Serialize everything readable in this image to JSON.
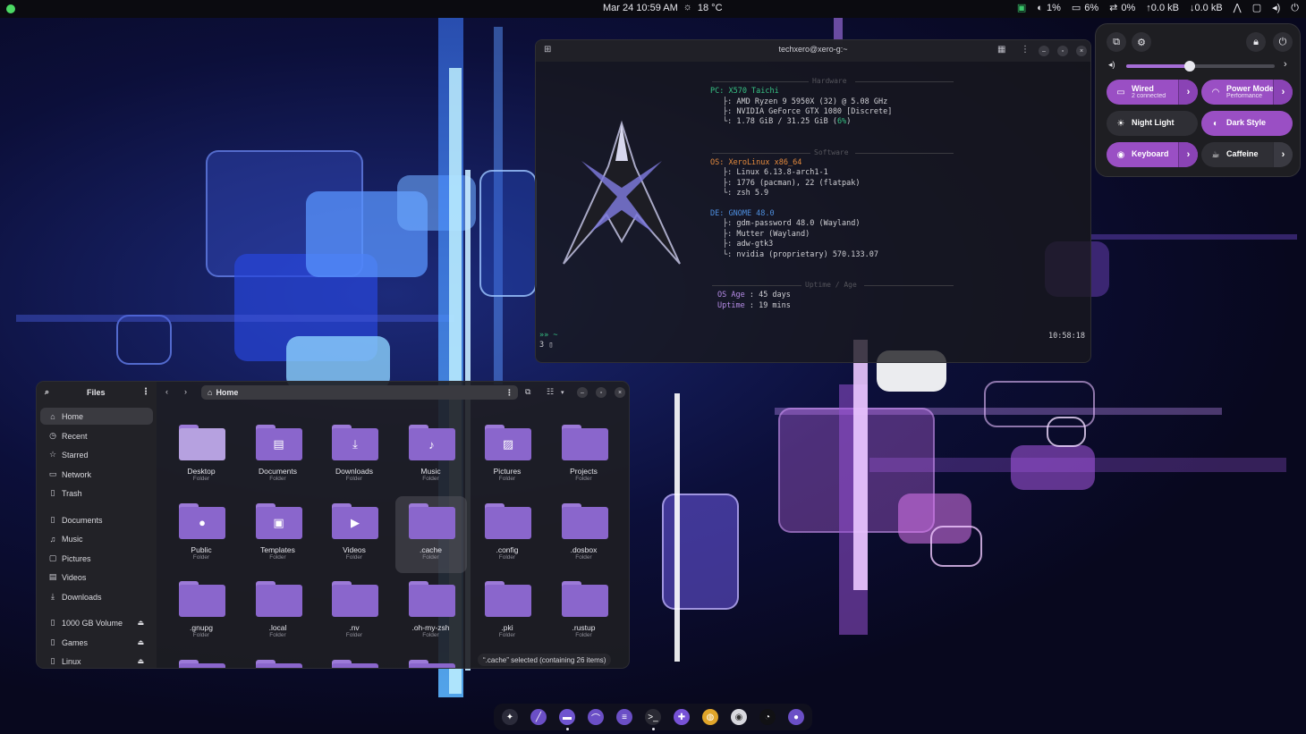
{
  "topbar": {
    "datetime": "Mar 24  10:59 AM",
    "weather": "18 °C",
    "cpu": "1%",
    "mem": "6%",
    "swap": "0%",
    "net_up": "↑0.0 kB",
    "net_down": "↓0.0 kB"
  },
  "quick_settings": {
    "volume_level": 0.43,
    "tiles": [
      {
        "label": "Wired",
        "sub": "2 connected",
        "on": true,
        "arrow": true,
        "icon": "wired-icon"
      },
      {
        "label": "Power Mode",
        "sub": "Performance",
        "on": true,
        "arrow": true,
        "icon": "power-mode-icon"
      },
      {
        "label": "Night Light",
        "sub": "",
        "on": false,
        "arrow": false,
        "icon": "night-light-icon"
      },
      {
        "label": "Dark Style",
        "sub": "",
        "on": true,
        "arrow": false,
        "icon": "dark-style-icon"
      },
      {
        "label": "Keyboard",
        "sub": "",
        "on": true,
        "arrow": true,
        "icon": "keyboard-icon"
      },
      {
        "label": "Caffeine",
        "sub": "",
        "on": false,
        "arrow": true,
        "icon": "caffeine-icon"
      }
    ]
  },
  "terminal": {
    "title": "techxero@xero-g:~",
    "hardware_title": "Hardware",
    "software_title": "Software",
    "uptime_title": "Uptime / Age",
    "hw": {
      "pc": "PC: X570 Taichi",
      "cpu": "├: AMD Ryzen 9 5950X (32) @ 5.08 GHz",
      "gpu": "├: NVIDIA GeForce GTX 1080 [Discrete]",
      "mem_prefix": "└: 1.78 GiB / 31.25 GiB (",
      "mem_pct": "6%",
      "mem_suffix": ")"
    },
    "sw": {
      "os": "OS: XeroLinux x86_64",
      "kernel": "├: Linux 6.13.8-arch1-1",
      "pkgs": "├: 1776 (pacman), 22 (flatpak)",
      "shell": "└: zsh 5.9",
      "de": "DE: GNOME 48.0",
      "dm": "├: gdm-password 48.0 (Wayland)",
      "wm": "├: Mutter (Wayland)",
      "theme": "├: adw-gtk3",
      "driver": "└: nvidia (proprietary) 570.133.07"
    },
    "age_label": "OS Age",
    "age_value": ": 45 days",
    "uptime_label": "Uptime",
    "uptime_value": ": 19 mins",
    "prompt_line1": "»» ~",
    "prompt_line2": "3 ▯",
    "clock": "10:58:18"
  },
  "files": {
    "sidebar_title": "Files",
    "path": "Home",
    "sidebar": [
      {
        "label": "Home",
        "icon": "home-icon",
        "active": true,
        "eject": false
      },
      {
        "label": "Recent",
        "icon": "recent-icon",
        "active": false,
        "eject": false
      },
      {
        "label": "Starred",
        "icon": "star-icon",
        "active": false,
        "eject": false
      },
      {
        "label": "Network",
        "icon": "network-icon",
        "active": false,
        "eject": false
      },
      {
        "label": "Trash",
        "icon": "trash-icon",
        "active": false,
        "eject": false
      },
      {
        "label": "Documents",
        "icon": "documents-icon",
        "active": false,
        "eject": false
      },
      {
        "label": "Music",
        "icon": "music-icon",
        "active": false,
        "eject": false
      },
      {
        "label": "Pictures",
        "icon": "pictures-icon",
        "active": false,
        "eject": false
      },
      {
        "label": "Videos",
        "icon": "videos-icon",
        "active": false,
        "eject": false
      },
      {
        "label": "Downloads",
        "icon": "downloads-icon",
        "active": false,
        "eject": false
      },
      {
        "label": "1000 GB Volume",
        "icon": "drive-icon",
        "active": false,
        "eject": true
      },
      {
        "label": "Games",
        "icon": "drive-icon",
        "active": false,
        "eject": true
      },
      {
        "label": "Linux",
        "icon": "drive-icon",
        "active": false,
        "eject": true
      }
    ],
    "items": [
      {
        "name": "Desktop",
        "type": "Folder",
        "emblem": ""
      },
      {
        "name": "Documents",
        "type": "Folder",
        "emblem": "documents"
      },
      {
        "name": "Downloads",
        "type": "Folder",
        "emblem": "downloads"
      },
      {
        "name": "Music",
        "type": "Folder",
        "emblem": "music"
      },
      {
        "name": "Pictures",
        "type": "Folder",
        "emblem": "pictures"
      },
      {
        "name": "Projects",
        "type": "Folder",
        "emblem": ""
      },
      {
        "name": "Public",
        "type": "Folder",
        "emblem": "public"
      },
      {
        "name": "Templates",
        "type": "Folder",
        "emblem": "templates"
      },
      {
        "name": "Videos",
        "type": "Folder",
        "emblem": "videos"
      },
      {
        "name": ".cache",
        "type": "Folder",
        "emblem": "",
        "selected": true
      },
      {
        "name": ".config",
        "type": "Folder",
        "emblem": ""
      },
      {
        "name": ".dosbox",
        "type": "Folder",
        "emblem": ""
      },
      {
        "name": ".gnupg",
        "type": "Folder",
        "emblem": ""
      },
      {
        "name": ".local",
        "type": "Folder",
        "emblem": ""
      },
      {
        "name": ".nv",
        "type": "Folder",
        "emblem": ""
      },
      {
        "name": ".oh-my-zsh",
        "type": "Folder",
        "emblem": ""
      },
      {
        "name": ".pki",
        "type": "Folder",
        "emblem": ""
      },
      {
        "name": ".rustup",
        "type": "Folder",
        "emblem": ""
      }
    ],
    "status": "“.cache” selected  (containing 26 items)"
  },
  "dock": [
    {
      "name": "xerolinux-icon",
      "color": "#2b2b3a",
      "glyph": "✦",
      "running": false
    },
    {
      "name": "sword-app-icon",
      "color": "#6b4fc6",
      "glyph": "╱",
      "running": false
    },
    {
      "name": "files-app-icon",
      "color": "#6f55cf",
      "glyph": "▬",
      "running": true
    },
    {
      "name": "network-app-icon",
      "color": "#6b4fc6",
      "glyph": "⌒",
      "running": false
    },
    {
      "name": "settings-app-icon",
      "color": "#6b4fc6",
      "glyph": "≡",
      "running": false
    },
    {
      "name": "terminal-app-icon",
      "color": "#2a2a34",
      "glyph": ">_",
      "running": true
    },
    {
      "name": "extensions-app-icon",
      "color": "#7752d6",
      "glyph": "✚",
      "running": false
    },
    {
      "name": "browser-app-icon",
      "color": "#e0a52a",
      "glyph": "◍",
      "running": false
    },
    {
      "name": "disc-app-icon",
      "color": "#d8d8de",
      "glyph": "◉",
      "running": false
    },
    {
      "name": "pacman-app-icon",
      "color": "#111114",
      "glyph": "◔",
      "running": false
    },
    {
      "name": "toggle-app-icon",
      "color": "#6b4fc6",
      "glyph": "●",
      "running": false
    }
  ]
}
